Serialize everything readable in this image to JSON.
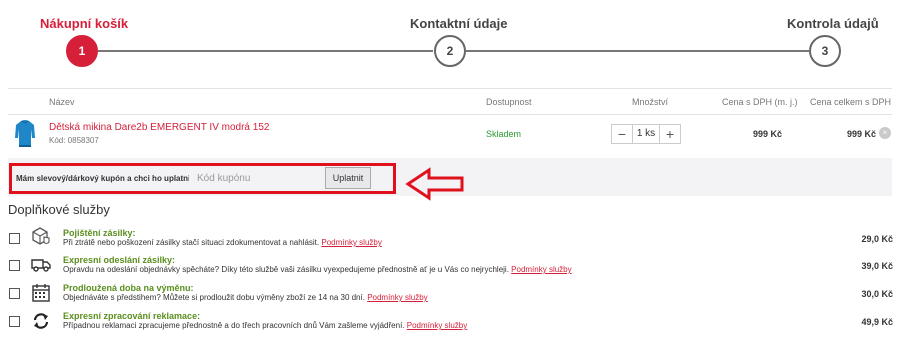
{
  "steps": [
    {
      "label": "Nákupní košík",
      "number": "1"
    },
    {
      "label": "Kontaktní údaje",
      "number": "2"
    },
    {
      "label": "Kontrola údajů",
      "number": "3"
    }
  ],
  "table": {
    "headers": {
      "name": "Název",
      "availability": "Dostupnost",
      "quantity": "Množství",
      "unit_price": "Cena s DPH (m. j.)",
      "total_price": "Cena celkem s DPH"
    }
  },
  "product": {
    "name": "Dětská mikina Dare2b EMERGENT IV modrá 152",
    "code": "Kód: 0858307",
    "availability": "Skladem",
    "quantity": "1 ks",
    "minus": "−",
    "plus": "+",
    "unit_price": "999 Kč",
    "total_price": "999 Kč",
    "remove": "×"
  },
  "coupon": {
    "label": "Mám slevový/dárkový kupón a chci ho uplatnit:",
    "placeholder": "Kód kupónu",
    "button": "Uplatnit"
  },
  "services": {
    "title": "Doplňkové služby",
    "items": [
      {
        "icon": "package-shield-icon",
        "title": "Pojištění zásilky:",
        "desc": "Při ztrátě nebo poškození zásilky stačí situaci zdokumentovat a nahlásit.",
        "link": "Podmínky služby",
        "price": "29,0 Kč"
      },
      {
        "icon": "delivery-truck-icon",
        "title": "Expresní odeslání zásilky:",
        "desc": "Opravdu na odeslání objednávky spěcháte? Díky této službě vaši zásilku vyexpedujeme přednostně ať je u Vás co nejrychleji.",
        "link": "Podmínky služby",
        "price": "39,0 Kč"
      },
      {
        "icon": "calendar-icon",
        "title": "Prodloužená doba na výměnu:",
        "desc": "Objednáváte s předstihem? Můžete si prodloužit dobu výměny zboží ze 14 na 30 dní.",
        "link": "Podmínky služby",
        "price": "30,0 Kč"
      },
      {
        "icon": "refresh-arrows-icon",
        "title": "Expresní zpracování reklamace:",
        "desc": "Případnou reklamaci zpracujeme přednostně a do třech pracovních dnů Vám zašleme vyjádření.",
        "link": "Podmínky služby",
        "price": "49,9 Kč"
      }
    ]
  },
  "colors": {
    "brand_red": "#d6203a",
    "annotation_red": "#e0101d",
    "stock_green": "#2e9a34",
    "service_green": "#5a8f1e"
  }
}
